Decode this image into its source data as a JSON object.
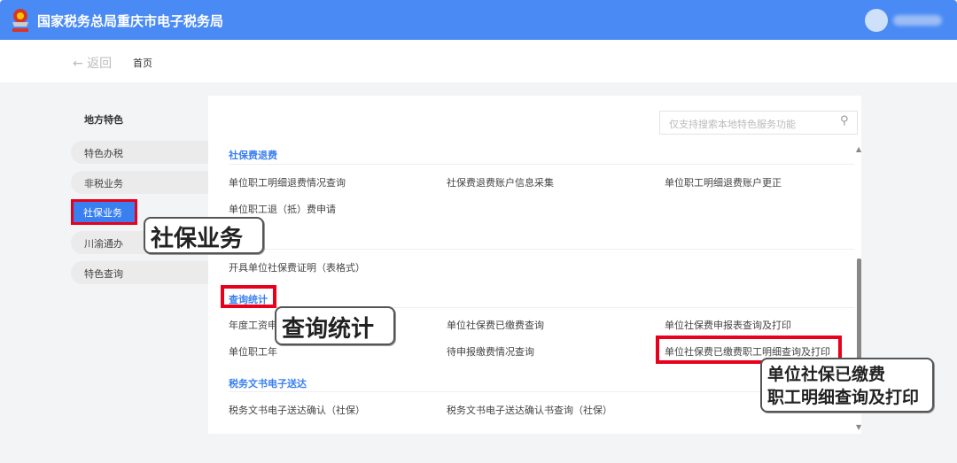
{
  "header": {
    "title": "国家税务总局重庆市电子税务局",
    "logo_icon": "tax-emblem-icon"
  },
  "nav": {
    "back": "← 返回",
    "home": "首页"
  },
  "sidebar": {
    "title": "地方特色",
    "items": [
      {
        "label": "特色办税"
      },
      {
        "label": "非税业务"
      },
      {
        "label": "社保业务",
        "active": true
      },
      {
        "label": "川渝通办"
      },
      {
        "label": "特色查询"
      }
    ]
  },
  "search": {
    "placeholder": "仅支持搜索本地特色服务功能"
  },
  "sections": [
    {
      "title": "社保费退费",
      "items": [
        "单位职工明细退费情况查询",
        "社保费退费账户信息采集",
        "单位职工明细退费账户更正",
        "单位职工退（抵）费申请"
      ]
    },
    {
      "items": [
        "开具单位社保费证明（表格式）"
      ]
    },
    {
      "title": "查询统计",
      "items": [
        "年度工资申",
        "单位社保费已缴费查询",
        "单位社保费申报表查询及打印",
        "单位职工年",
        "待申报缴费情况查询",
        "单位社保费已缴费职工明细查询及打印"
      ]
    },
    {
      "title": "税务文书电子送达",
      "items": [
        "税务文书电子送达确认（社保）",
        "税务文书电子送达确认书查询（社保）"
      ]
    }
  ],
  "callouts": {
    "c1": "社保业务",
    "c2": "查询统计",
    "c3a": "单位社保已缴费",
    "c3b": "职工明细查询及打印"
  },
  "colors": {
    "header": "#4a8af4",
    "accent": "#3a7ff0",
    "highlight": "#e8001c"
  }
}
